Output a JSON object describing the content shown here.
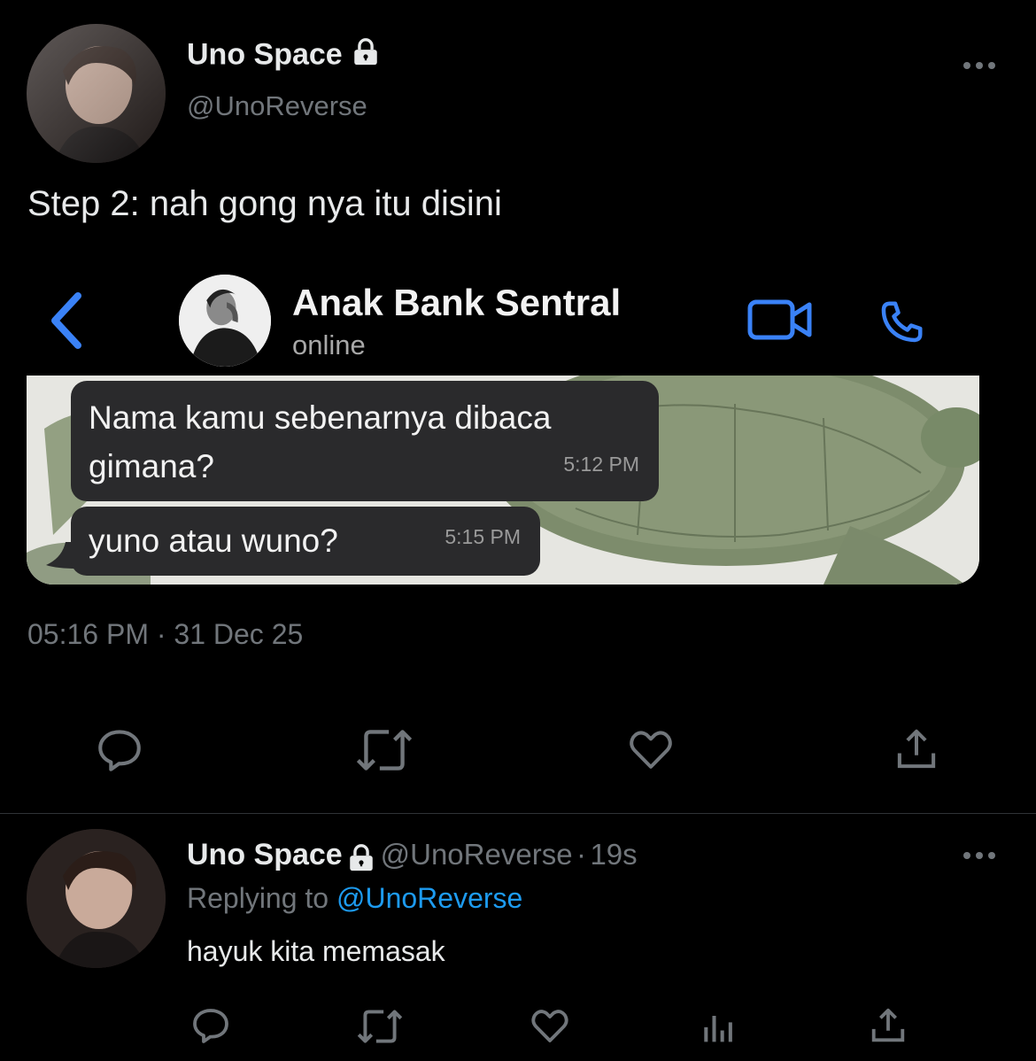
{
  "tweet": {
    "author_name": "Uno Space",
    "author_handle": "@UnoReverse",
    "text": "Step 2: nah gong nya itu disini",
    "time": "05:16 PM",
    "separator": "·",
    "date": "31 Dec 25"
  },
  "chat": {
    "contact_name": "Anak Bank Sentral",
    "status": "online",
    "messages": [
      {
        "text_line1": "Nama kamu sebenarnya dibaca",
        "text_line2": "gimana?",
        "time": "5:12 PM"
      },
      {
        "text_line1": "yuno atau wuno?",
        "time": "5:15 PM"
      }
    ]
  },
  "reply": {
    "author_name": "Uno Space",
    "author_handle": "@UnoReverse",
    "separator": "·",
    "age": "19s",
    "replying_prefix": "Replying to",
    "replying_to": "@UnoReverse",
    "text": "hayuk kita memasak"
  },
  "icons": {
    "lock": "lock-icon",
    "more": "more-horizontal-icon",
    "reply": "reply-bubble-icon",
    "retweet": "retweet-icon",
    "like": "heart-icon",
    "share": "share-upload-icon",
    "views": "analytics-bars-icon",
    "back": "chevron-left-icon",
    "video": "video-camera-icon",
    "phone": "phone-icon"
  },
  "colors": {
    "background": "#000000",
    "text": "#e7e9ea",
    "muted": "#71767b",
    "link": "#1d9bf0",
    "ios_blue": "#3a82f7"
  }
}
